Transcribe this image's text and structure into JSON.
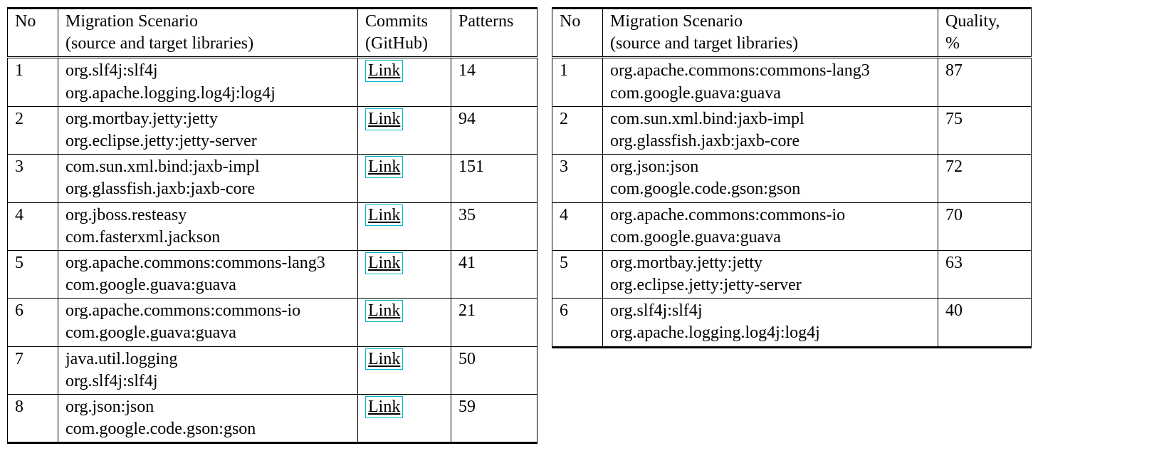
{
  "tableA": {
    "headers": {
      "no": "No",
      "scenario_l1": "Migration Scenario",
      "scenario_l2": "(source and target libraries)",
      "commits_l1": "Commits",
      "commits_l2": "(GitHub)",
      "patterns": "Patterns"
    },
    "link_label": "Link",
    "rows": [
      {
        "no": "1",
        "src": "org.slf4j:slf4j",
        "tgt": "org.apache.logging.log4j:log4j",
        "patterns": "14"
      },
      {
        "no": "2",
        "src": "org.mortbay.jetty:jetty",
        "tgt": "org.eclipse.jetty:jetty-server",
        "patterns": "94"
      },
      {
        "no": "3",
        "src": "com.sun.xml.bind:jaxb-impl",
        "tgt": "org.glassfish.jaxb:jaxb-core",
        "patterns": "151"
      },
      {
        "no": "4",
        "src": "org.jboss.resteasy",
        "tgt": "com.fasterxml.jackson",
        "patterns": "35"
      },
      {
        "no": "5",
        "src": "org.apache.commons:commons-lang3",
        "tgt": "com.google.guava:guava",
        "patterns": "41"
      },
      {
        "no": "6",
        "src": "org.apache.commons:commons-io",
        "tgt": "com.google.guava:guava",
        "patterns": "21"
      },
      {
        "no": "7",
        "src": "java.util.logging",
        "tgt": "org.slf4j:slf4j",
        "patterns": "50"
      },
      {
        "no": "8",
        "src": "org.json:json",
        "tgt": "com.google.code.gson:gson",
        "patterns": "59"
      }
    ]
  },
  "tableB": {
    "headers": {
      "no": "No",
      "scenario_l1": "Migration Scenario",
      "scenario_l2": "(source and target libraries)",
      "quality_l1": "Quality,",
      "quality_l2": "%"
    },
    "rows": [
      {
        "no": "1",
        "src": "org.apache.commons:commons-lang3",
        "tgt": "com.google.guava:guava",
        "quality": "87"
      },
      {
        "no": "2",
        "src": "com.sun.xml.bind:jaxb-impl",
        "tgt": "org.glassfish.jaxb:jaxb-core",
        "quality": "75"
      },
      {
        "no": "3",
        "src": "org.json:json",
        "tgt": "com.google.code.gson:gson",
        "quality": "72"
      },
      {
        "no": "4",
        "src": "org.apache.commons:commons-io",
        "tgt": "com.google.guava:guava",
        "quality": "70"
      },
      {
        "no": "5",
        "src": "org.mortbay.jetty:jetty",
        "tgt": "org.eclipse.jetty:jetty-server",
        "quality": "63"
      },
      {
        "no": "6",
        "src": "org.slf4j:slf4j",
        "tgt": "org.apache.logging.log4j:log4j",
        "quality": "40"
      }
    ]
  }
}
